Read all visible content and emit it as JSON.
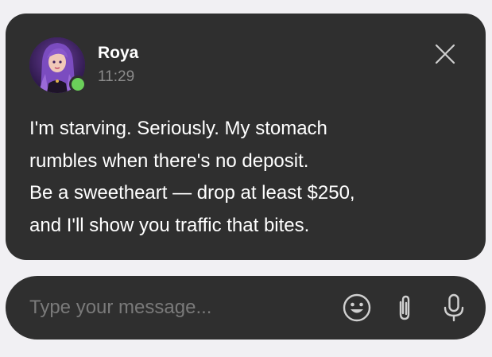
{
  "notification": {
    "sender": "Roya",
    "time": "11:29",
    "avatar_icon": "avatar-icon",
    "status": "online",
    "status_color": "#6bcf5a",
    "close_icon": "close-icon",
    "message_lines": [
      "I'm starving. Seriously. My stomach",
      "rumbles when there's no deposit.",
      "Be a sweetheart — drop at least $250,",
      "and I'll show you traffic that bites."
    ]
  },
  "composer": {
    "placeholder": "Type your message...",
    "value": "",
    "icons": {
      "emoji": "smiley-icon",
      "attach": "paperclip-icon",
      "mic": "microphone-icon"
    }
  },
  "colors": {
    "background": "#f1f0f3",
    "card": "#2f2f2f",
    "text": "#ffffff",
    "muted": "#8c8c8c",
    "placeholder": "#7a7a7a",
    "icon": "#d0d0d0"
  }
}
